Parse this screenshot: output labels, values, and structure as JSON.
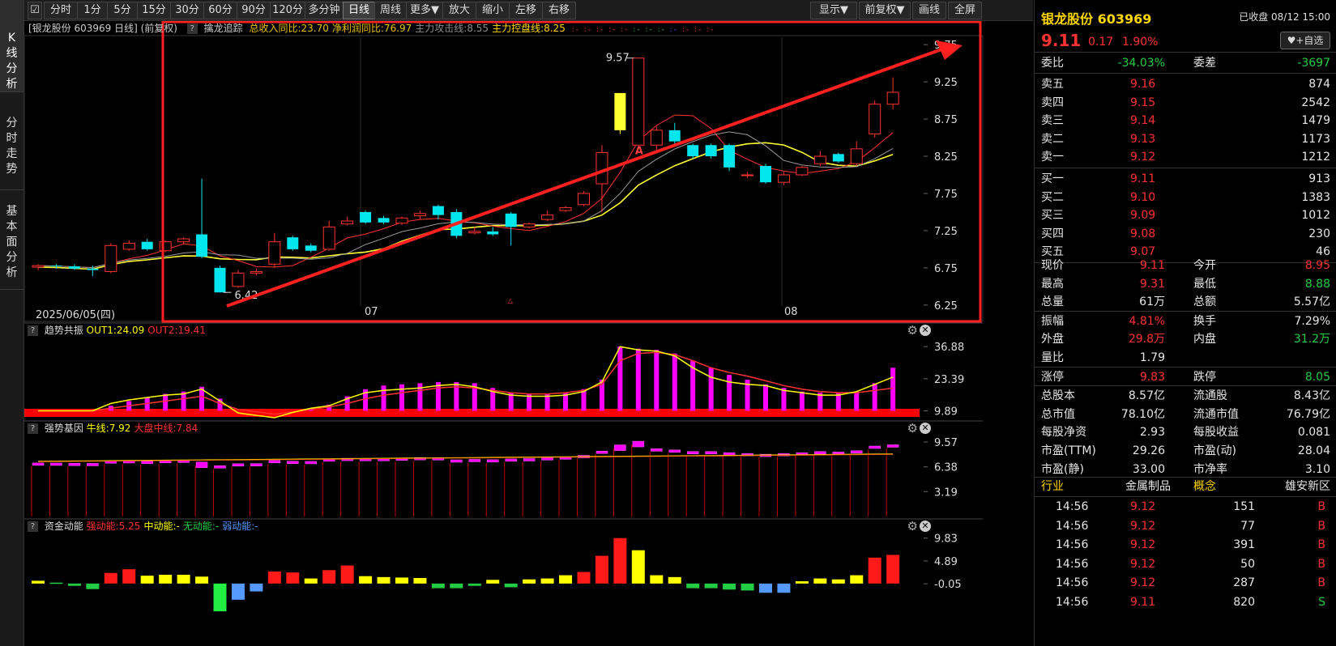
{
  "left_tabs": [
    {
      "label": "K线分析"
    },
    {
      "label": "分时走势"
    },
    {
      "label": "基本面分析"
    }
  ],
  "toolbar": {
    "items": [
      "分时",
      "1分",
      "5分",
      "15分",
      "30分",
      "60分",
      "90分",
      "120分",
      "多分钟",
      "日线",
      "周线",
      "更多▼",
      "放大",
      "缩小",
      "左移",
      "右移"
    ],
    "active": "日线",
    "right_items": [
      "显示▼",
      "前复权▼",
      "画线",
      "全屏"
    ]
  },
  "main_panel": {
    "title": "[银龙股份 603969 日线]  (前复权)",
    "indicator_name": "擒龙追踪",
    "params": [
      {
        "text": "总收入同比:23.70",
        "color": "#e6c000"
      },
      {
        "text": "净利润同比:76.97",
        "color": "#e6c000"
      },
      {
        "text": "主力攻击线:8.55",
        "color": "#8c8c8c"
      },
      {
        "text": "主力控盘线:8.25",
        "color": "#ffd700"
      }
    ],
    "y_axis": [
      "9.75",
      "9.25",
      "8.75",
      "8.25",
      "7.75",
      "7.25",
      "6.75",
      "6.25"
    ],
    "date_label": "2025/06/05(四)",
    "month_labels": [
      "07",
      "08"
    ],
    "high_label": "9.57",
    "low_label": "6.42"
  },
  "panel2": {
    "name": "趋势共振",
    "params": [
      {
        "text": "OUT1:24.09",
        "color": "#ffff00"
      },
      {
        "text": "OUT2:19.41",
        "color": "#ff3232"
      }
    ],
    "y_axis": [
      "36.88",
      "23.39",
      "9.89"
    ]
  },
  "panel3": {
    "name": "强势基因",
    "params": [
      {
        "text": "牛线:7.92",
        "color": "#ffff00"
      },
      {
        "text": "大盘中线:7.84",
        "color": "#ff3232"
      }
    ],
    "y_axis": [
      "9.57",
      "6.38",
      "3.19"
    ]
  },
  "panel4": {
    "name": "资金动能",
    "params": [
      {
        "text": "强动能:5.25",
        "color": "#ff3232"
      },
      {
        "text": "中动能:-",
        "color": "#ffff00"
      },
      {
        "text": "无动能:-",
        "color": "#22cc44"
      },
      {
        "text": "弱动能:-",
        "color": "#5599ff"
      }
    ],
    "y_axis": [
      "9.83",
      "4.89",
      "-0.05"
    ]
  },
  "quote": {
    "name": "银龙股份 603969",
    "status": "已收盘 08/12 15:00",
    "price": "9.11",
    "change": "0.17",
    "pct": "1.90%",
    "watch": "+自选",
    "weibi_label": "委比",
    "weibi": "-34.03%",
    "weicha_label": "委差",
    "weicha": "-3697",
    "sells": [
      [
        "卖五",
        "9.16",
        "874"
      ],
      [
        "卖四",
        "9.15",
        "2542"
      ],
      [
        "卖三",
        "9.14",
        "1479"
      ],
      [
        "卖二",
        "9.13",
        "1173"
      ],
      [
        "卖一",
        "9.12",
        "1212"
      ]
    ],
    "buys": [
      [
        "买一",
        "9.11",
        "913"
      ],
      [
        "买二",
        "9.10",
        "1383"
      ],
      [
        "买三",
        "9.09",
        "1012"
      ],
      [
        "买四",
        "9.08",
        "230"
      ],
      [
        "买五",
        "9.07",
        "46"
      ]
    ],
    "stats": [
      [
        [
          "现价",
          "9.11",
          "red"
        ],
        [
          "今开",
          "8.95",
          "red"
        ]
      ],
      [
        [
          "最高",
          "9.31",
          "red"
        ],
        [
          "最低",
          "8.88",
          "grn"
        ]
      ],
      [
        [
          "总量",
          "61万",
          "wht"
        ],
        [
          "总额",
          "5.57亿",
          "wht"
        ]
      ],
      [
        [
          "振幅",
          "4.81%",
          "red"
        ],
        [
          "换手",
          "7.29%",
          "wht"
        ]
      ],
      [
        [
          "外盘",
          "29.8万",
          "red"
        ],
        [
          "内盘",
          "31.2万",
          "grn"
        ]
      ],
      [
        [
          "量比",
          "1.79",
          "wht"
        ],
        [
          "",
          "",
          " "
        ]
      ],
      [
        [
          "涨停",
          "9.83",
          "red"
        ],
        [
          "跌停",
          "8.05",
          "grn"
        ]
      ],
      [
        [
          "总股本",
          "8.57亿",
          "wht"
        ],
        [
          "流通股",
          "8.43亿",
          "wht"
        ]
      ],
      [
        [
          "总市值",
          "78.10亿",
          "wht"
        ],
        [
          "流通市值",
          "76.79亿",
          "wht"
        ]
      ],
      [
        [
          "每股净资",
          "2.93",
          "wht"
        ],
        [
          "每股收益",
          "0.081",
          "wht"
        ]
      ],
      [
        [
          "市盈(TTM)",
          "29.26",
          "wht"
        ],
        [
          "市盈(动)",
          "28.04",
          "wht"
        ]
      ],
      [
        [
          "市盈(静)",
          "33.00",
          "wht"
        ],
        [
          "市净率",
          "3.10",
          "wht"
        ]
      ]
    ],
    "industry_label": "行业",
    "industry": "金属制品",
    "concept_label": "概念",
    "concept": "雄安新区",
    "ticks": [
      [
        "14:56",
        "9.12",
        "151",
        "B"
      ],
      [
        "14:56",
        "9.12",
        "77",
        "B"
      ],
      [
        "14:56",
        "9.12",
        "391",
        "B"
      ],
      [
        "14:56",
        "9.12",
        "50",
        "B"
      ],
      [
        "14:56",
        "9.12",
        "287",
        "B"
      ],
      [
        "14:56",
        "9.11",
        "820",
        "S"
      ]
    ]
  },
  "chart_data": {
    "type": "candlestick",
    "ylim": [
      6.25,
      9.75
    ],
    "candles": [
      [
        6.76,
        6.78,
        6.72,
        6.8
      ],
      [
        6.78,
        6.77,
        6.74,
        6.8
      ],
      [
        6.77,
        6.74,
        6.72,
        6.8
      ],
      [
        6.74,
        6.72,
        6.64,
        6.78
      ],
      [
        6.7,
        7.05,
        6.68,
        7.08
      ],
      [
        7.0,
        7.08,
        6.98,
        7.12
      ],
      [
        7.1,
        7.0,
        6.98,
        7.14
      ],
      [
        6.98,
        7.1,
        6.96,
        7.12
      ],
      [
        7.1,
        7.14,
        7.08,
        7.16
      ],
      [
        7.2,
        6.9,
        6.88,
        7.95
      ],
      [
        6.75,
        6.42,
        6.42,
        6.78
      ],
      [
        6.5,
        6.68,
        6.48,
        6.72
      ],
      [
        6.68,
        6.7,
        6.65,
        6.74
      ],
      [
        6.8,
        7.1,
        6.75,
        7.22
      ],
      [
        7.16,
        7.0,
        6.98,
        7.18
      ],
      [
        7.05,
        6.98,
        6.96,
        7.08
      ],
      [
        7.0,
        7.3,
        6.98,
        7.38
      ],
      [
        7.34,
        7.38,
        7.32,
        7.44
      ],
      [
        7.5,
        7.36,
        7.34,
        7.52
      ],
      [
        7.42,
        7.36,
        7.34,
        7.45
      ],
      [
        7.35,
        7.42,
        7.33,
        7.44
      ],
      [
        7.45,
        7.48,
        7.4,
        7.52
      ],
      [
        7.58,
        7.46,
        7.4,
        7.6
      ],
      [
        7.5,
        7.18,
        7.15,
        7.54
      ],
      [
        7.22,
        7.24,
        7.2,
        7.3
      ],
      [
        7.24,
        7.2,
        7.18,
        7.3
      ],
      [
        7.48,
        7.3,
        7.05,
        7.5
      ],
      [
        7.3,
        7.34,
        7.28,
        7.36
      ],
      [
        7.4,
        7.46,
        7.38,
        7.52
      ],
      [
        7.52,
        7.56,
        7.5,
        7.58
      ],
      [
        7.6,
        7.75,
        7.58,
        7.78
      ],
      [
        7.88,
        8.3,
        7.5,
        8.4
      ],
      [
        8.6,
        9.1,
        8.55,
        9.1
      ],
      [
        8.4,
        9.57,
        8.4,
        9.57
      ],
      [
        8.4,
        8.6,
        8.3,
        8.65
      ],
      [
        8.6,
        8.45,
        8.38,
        8.7
      ],
      [
        8.4,
        8.25,
        8.22,
        8.42
      ],
      [
        8.4,
        8.25,
        8.22,
        8.42
      ],
      [
        8.4,
        8.1,
        8.05,
        8.42
      ],
      [
        8.0,
        8.0,
        7.96,
        8.04
      ],
      [
        8.12,
        7.9,
        7.88,
        8.15
      ],
      [
        7.9,
        8.0,
        7.86,
        8.04
      ],
      [
        8.0,
        8.1,
        7.98,
        8.12
      ],
      [
        8.15,
        8.25,
        8.12,
        8.32
      ],
      [
        8.28,
        8.18,
        8.16,
        8.3
      ],
      [
        8.15,
        8.35,
        8.12,
        8.45
      ],
      [
        8.55,
        8.95,
        8.5,
        9.0
      ],
      [
        8.95,
        9.11,
        8.88,
        9.31
      ]
    ],
    "panel2_out1": [
      9.89,
      9.9,
      9.9,
      9.9,
      13,
      14.5,
      15.5,
      16.5,
      17,
      19,
      14,
      9,
      8,
      7,
      9.2,
      11,
      12,
      15,
      17.5,
      18.5,
      19,
      19.5,
      20.5,
      21,
      20,
      18,
      16.5,
      16,
      16,
      16.5,
      18,
      22,
      36.88,
      35.5,
      35,
      33,
      28,
      24,
      22,
      21,
      20.5,
      18.5,
      17.5,
      16.5,
      16.5,
      18,
      21,
      24.09
    ],
    "panel2_out2": [
      9.89,
      9.89,
      9.89,
      9.89,
      11,
      12,
      13,
      14,
      15,
      16,
      13,
      10.5,
      9.5,
      8.5,
      9.5,
      10.5,
      11.5,
      13,
      15,
      16.5,
      17.5,
      18.5,
      19.5,
      20,
      19.5,
      18.5,
      17.5,
      17,
      17,
      17.5,
      18.5,
      21,
      31,
      34,
      34.5,
      33.5,
      31,
      28,
      26,
      24.5,
      22.5,
      20.5,
      19,
      18,
      17.5,
      17.5,
      18.5,
      19.41
    ],
    "panel2_bars": [
      9.89,
      9.89,
      9.89,
      9.89,
      12,
      14,
      15.5,
      17,
      18,
      20,
      15,
      9.89,
      9.89,
      9.89,
      9.89,
      11,
      12.5,
      16,
      19,
      20.5,
      21,
      21.5,
      22,
      22,
      21.5,
      19.5,
      17.5,
      17,
      17,
      17.5,
      19,
      23,
      36.88,
      36,
      35.5,
      34,
      31,
      28,
      25,
      23,
      21,
      19.5,
      18,
      17.5,
      17.5,
      18,
      21.5,
      28
    ],
    "panel3_bars": [
      6.78,
      6.77,
      6.74,
      6.72,
      7.05,
      7.08,
      7.0,
      7.1,
      7.14,
      6.9,
      6.42,
      6.68,
      6.7,
      7.1,
      7.0,
      6.98,
      7.3,
      7.38,
      7.36,
      7.36,
      7.42,
      7.48,
      7.46,
      7.18,
      7.24,
      7.2,
      7.3,
      7.34,
      7.46,
      7.56,
      7.75,
      8.3,
      9.1,
      9.57,
      8.6,
      8.45,
      8.25,
      8.25,
      8.1,
      8.0,
      7.9,
      8.0,
      8.1,
      8.25,
      8.18,
      8.35,
      8.95,
      9.11
    ],
    "panel4_values": [
      0.6,
      0.2,
      -0.5,
      -1.2,
      2.3,
      3.1,
      1.7,
      1.9,
      1.9,
      1.5,
      -6.0,
      -3.5,
      -1.7,
      2.6,
      2.4,
      1.1,
      2.9,
      3.9,
      1.6,
      1.4,
      1.3,
      1.2,
      -1.0,
      -1.0,
      -0.5,
      0.8,
      -0.8,
      0.9,
      1.1,
      1.8,
      2.5,
      6.0,
      9.83,
      7.2,
      1.8,
      1.4,
      -1.0,
      -1.0,
      -1.3,
      -1.5,
      -2.0,
      -2.0,
      0.5,
      1.1,
      0.9,
      1.8,
      5.6,
      6.2
    ]
  }
}
